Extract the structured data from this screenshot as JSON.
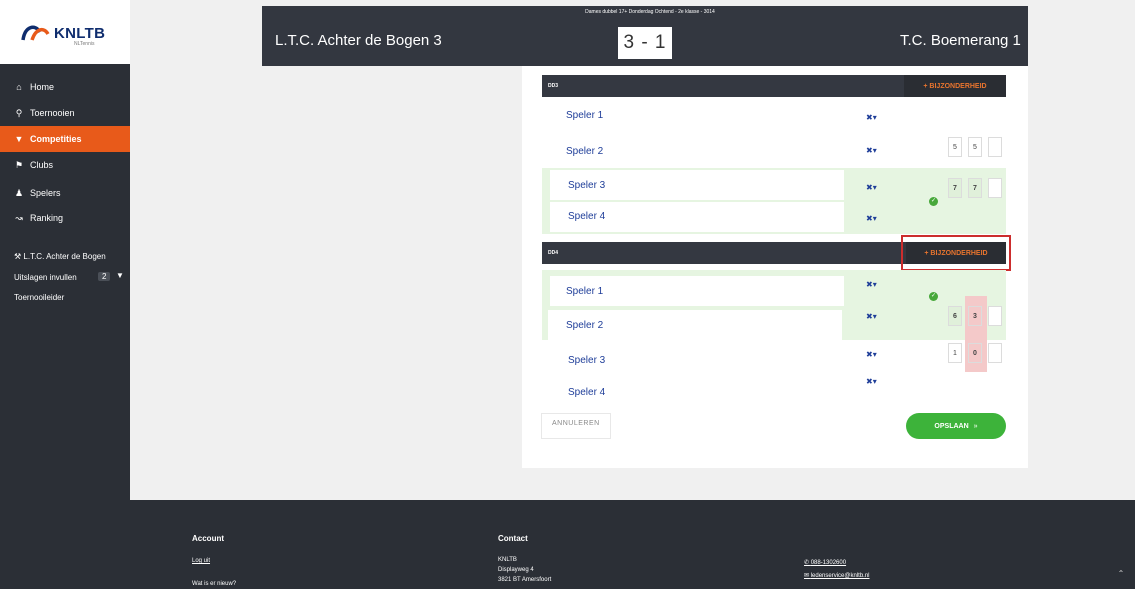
{
  "brand": {
    "name": "KNLTB",
    "tagline": "NLTennis"
  },
  "sidebar": {
    "items": [
      {
        "label": "Home",
        "icon": "home-icon"
      },
      {
        "label": "Toernooien",
        "icon": "trophy-icon"
      },
      {
        "label": "Competities",
        "icon": "cup-icon"
      },
      {
        "label": "Clubs",
        "icon": "flag-icon"
      },
      {
        "label": "Spelers",
        "icon": "players-icon"
      },
      {
        "label": "Ranking",
        "icon": "chart-icon"
      }
    ],
    "club": "L.T.C. Achter de Bogen",
    "uitslagen": "Uitslagen invullen",
    "uitslagen_count": "2",
    "toernooileider": "Toernooileider"
  },
  "header": {
    "competition": "Dames dubbel 17+ Donderdag Ochtend - 2e klasse - 3014",
    "home_team": "L.T.C. Achter de Bogen 3",
    "away_team": "T.C. Boemerang 1",
    "score": "3 - 1"
  },
  "matches": [
    {
      "code": "DD3",
      "bijzonderheid": "+ BIJZONDERHEID",
      "players": [
        "Speler 1",
        "Speler 2",
        "Speler 3",
        "Speler 4"
      ],
      "team1_scores": [
        "5",
        "5"
      ],
      "team2_scores": [
        "7",
        "7"
      ],
      "winner": 2
    },
    {
      "code": "DD4",
      "bijzonderheid": "+ BIJZONDERHEID",
      "players": [
        "Speler 1",
        "Speler 2",
        "Speler 3",
        "Speler 4"
      ],
      "team1_scores": [
        "6",
        "3"
      ],
      "team2_scores": [
        "1",
        "0"
      ],
      "winner": 1
    }
  ],
  "actions": {
    "cancel": "ANNULEREN",
    "save": "OPSLAAN"
  },
  "footer": {
    "account_title": "Account",
    "logout": "Log uit",
    "whats_new": "Wat is er nieuw?",
    "contact_title": "Contact",
    "org": "KNLTB",
    "street": "Displayweg 4",
    "city": "3821 BT Amersfoort",
    "phone": "088-1302600",
    "email": "ledenservice@knltb.nl"
  },
  "colors": {
    "accent": "#e85a1a",
    "highlight": "#cc2d2d",
    "save": "#3db33a",
    "sidebar": "#2b2f36"
  }
}
